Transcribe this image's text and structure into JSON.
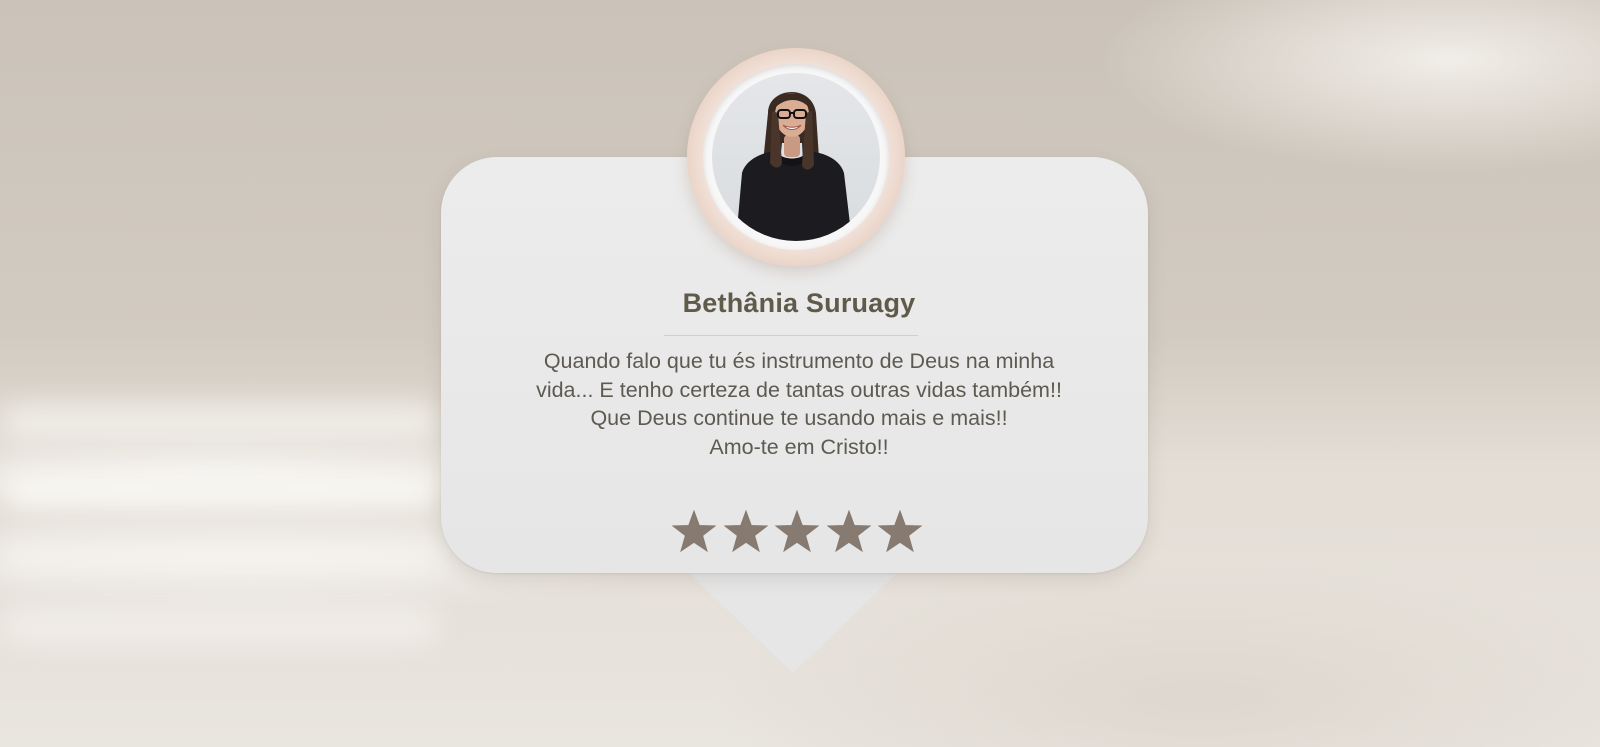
{
  "testimonial": {
    "name": "Bethânia Suruagy",
    "quote_lines": [
      "Quando falo que tu és instrumento de Deus na minha",
      "vida... E tenho certeza de tantas outras vidas também!!",
      "Que Deus continue te usando mais e mais!!",
      "Amo-te em Cristo!!"
    ],
    "rating": 5,
    "rating_max": 5
  },
  "icons": {
    "star": "star-icon",
    "avatar": "person-photo"
  },
  "colors": {
    "star": "#867a71",
    "name": "#5f5a4a",
    "text": "#5e5a52",
    "card": "#e8e8e8",
    "ring": "#e8cfc2"
  }
}
